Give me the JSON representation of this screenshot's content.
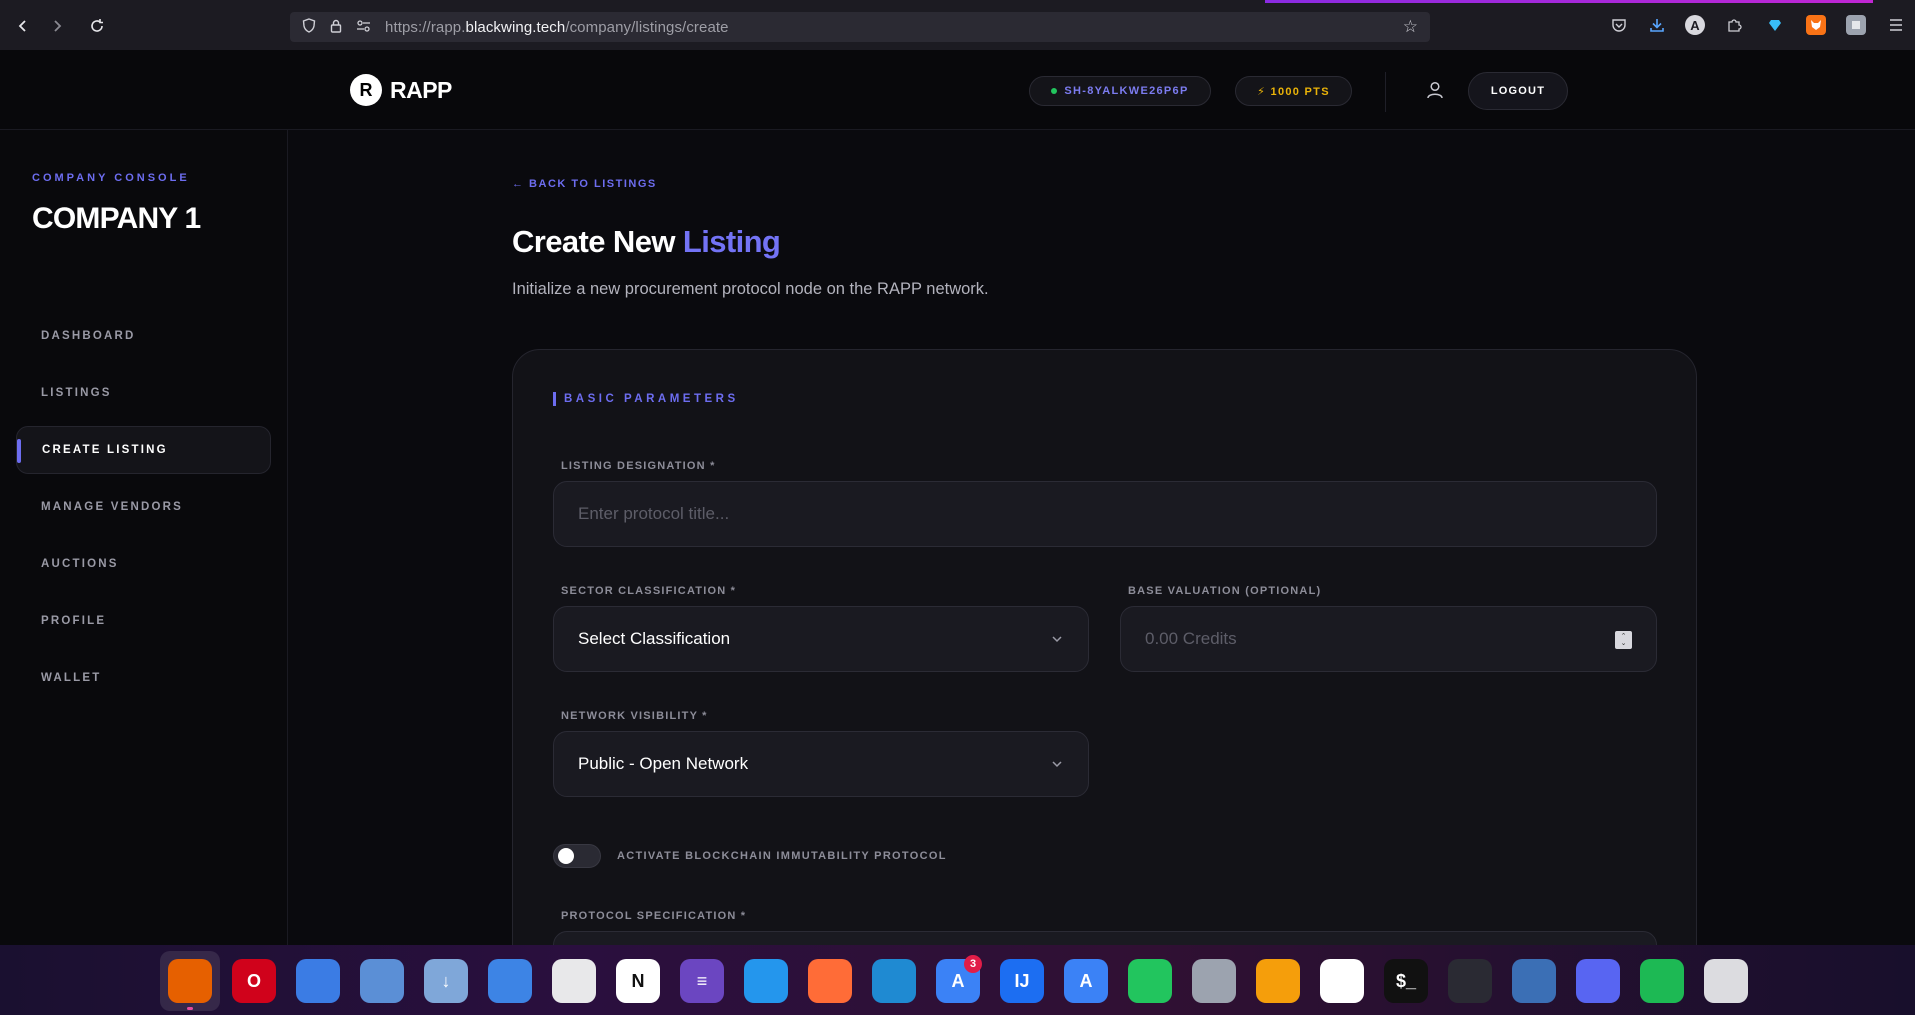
{
  "browser": {
    "url_prefix": "https://rapp.",
    "url_host": "blackwing.tech",
    "url_path": "/company/listings/create",
    "profile_initial": "A"
  },
  "header": {
    "logo_letter": "R",
    "logo_text": "RAPP",
    "session_id": "SH-8YALKWE26P6P",
    "points": "⚡ 1000 PTS",
    "logout_label": "LOGOUT"
  },
  "sidebar": {
    "console_label": "COMPANY CONSOLE",
    "company_name": "COMPANY 1",
    "items": [
      {
        "label": "DASHBOARD"
      },
      {
        "label": "LISTINGS"
      },
      {
        "label": "CREATE LISTING"
      },
      {
        "label": "MANAGE VENDORS"
      },
      {
        "label": "AUCTIONS"
      },
      {
        "label": "PROFILE"
      },
      {
        "label": "WALLET"
      }
    ],
    "active_label": "CREATE LISTING"
  },
  "main": {
    "back_link": "← BACK TO LISTINGS",
    "title_main": "Create New",
    "title_accent": "Listing",
    "subtitle": "Initialize a new procurement protocol node on the RAPP network.",
    "section_label": "BASIC PARAMETERS",
    "fields": {
      "designation_label": "LISTING DESIGNATION *",
      "designation_placeholder": "Enter protocol title...",
      "sector_label": "SECTOR CLASSIFICATION *",
      "sector_value": "Select Classification",
      "valuation_label": "BASE VALUATION (OPTIONAL)",
      "valuation_placeholder": "0.00 Credits",
      "visibility_label": "NETWORK VISIBILITY *",
      "visibility_value": "Public - Open Network",
      "blockchain_label": "ACTIVATE BLOCKCHAIN IMMUTABILITY PROTOCOL",
      "blockchain_enabled": false,
      "spec_label": "PROTOCOL SPECIFICATION *"
    }
  },
  "dock": {
    "apps": [
      {
        "name": "firefox",
        "glyph": "",
        "color": "#e66000",
        "active": true
      },
      {
        "name": "opera",
        "glyph": "O",
        "color": "#d0021b"
      },
      {
        "name": "chromium",
        "glyph": "",
        "color": "#3b7ce4"
      },
      {
        "name": "files",
        "glyph": "",
        "color": "#5b8fd6"
      },
      {
        "name": "downloads",
        "glyph": "↓",
        "color": "#7fa7d9"
      },
      {
        "name": "document-viewer",
        "glyph": "",
        "color": "#3d84e5"
      },
      {
        "name": "text-editor",
        "glyph": "",
        "color": "#e8e8ea"
      },
      {
        "name": "notion",
        "glyph": "N",
        "color": "#ffffff"
      },
      {
        "name": "planner",
        "glyph": "≡",
        "color": "#6b46c1"
      },
      {
        "name": "docker",
        "glyph": "",
        "color": "#2496ed"
      },
      {
        "name": "postman",
        "glyph": "",
        "color": "#ff6c37"
      },
      {
        "name": "vscode",
        "glyph": "",
        "color": "#1f8ad2"
      },
      {
        "name": "dev-tool",
        "glyph": "A",
        "color": "#3b82f6",
        "badge": "3"
      },
      {
        "name": "intellij",
        "glyph": "IJ",
        "color": "#1c6ef2"
      },
      {
        "name": "app-store",
        "glyph": "A",
        "color": "#3b82f6"
      },
      {
        "name": "gpu-monitor",
        "glyph": "",
        "color": "#22c55e"
      },
      {
        "name": "cube-app",
        "glyph": "",
        "color": "#9ca3af"
      },
      {
        "name": "postgres-tool",
        "glyph": "",
        "color": "#f59e0b"
      },
      {
        "name": "mongodb",
        "glyph": "",
        "color": "#ffffff"
      },
      {
        "name": "terminal",
        "glyph": "$_",
        "color": "#111111"
      },
      {
        "name": "toggle-app",
        "glyph": "",
        "color": "#2a2a33"
      },
      {
        "name": "system-monitor",
        "glyph": "",
        "color": "#3b6fb5"
      },
      {
        "name": "discord",
        "glyph": "",
        "color": "#5865f2"
      },
      {
        "name": "spotify",
        "glyph": "",
        "color": "#1db954"
      },
      {
        "name": "trash",
        "glyph": "",
        "color": "#dcdce0"
      }
    ]
  }
}
